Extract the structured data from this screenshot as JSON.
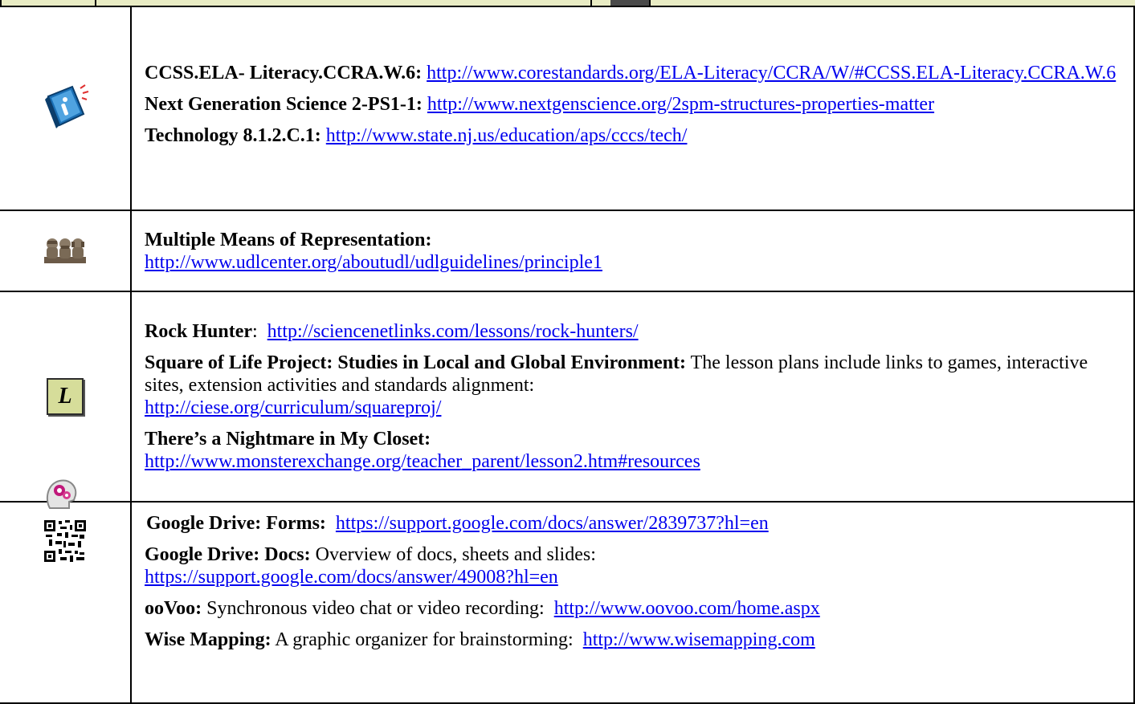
{
  "rows": [
    {
      "icon": "info-book-icon",
      "items": [
        {
          "label": "CCSS.ELA- Literacy.CCRA.W.6:",
          "text": "",
          "link": "http://www.corestandards.org/ELA-Literacy/CCRA/W/#CCSS.ELA-Literacy.CCRA.W.6"
        },
        {
          "label": "Next Generation Science 2-PS1-1:",
          "text": "",
          "link": "http://www.nextgenscience.org/2spm-structures-properties-matter"
        },
        {
          "label": "Technology 8.1.2.C.1:",
          "text": "",
          "link": "http://www.state.nj.us/education/aps/cccs/tech/"
        }
      ]
    },
    {
      "icon": "three-monkeys-icon",
      "items": [
        {
          "label": "Multiple Means of Representation:",
          "text": "",
          "link": "http://www.udlcenter.org/aboutudl/udlguidelines/principle1"
        }
      ]
    },
    {
      "icon": "lesson-l-icon",
      "icon_letter": "L",
      "items": [
        {
          "label": "Rock Hunter",
          "text": ":",
          "link": "http://sciencenetlinks.com/lessons/rock-hunters/"
        },
        {
          "label": "Square of Life Project:  Studies in Local and Global Environment:",
          "text": " The lesson plans include links to games, interactive sites, extension activities and standards alignment:",
          "link": "http://ciese.org/curriculum/squareproj/"
        },
        {
          "label": "There’s a Nightmare in My Closet:",
          "text": "",
          "link": "http://www.monsterexchange.org/teacher_parent/lesson2.htm#resources"
        }
      ]
    },
    {
      "icon": "qr-code-icon",
      "items": [
        {
          "label": "Google Drive: Forms:",
          "text": "",
          "link": "https://support.google.com/docs/answer/2839737?hl=en"
        },
        {
          "label": "Google Drive: Docs:",
          "text": "  Overview of docs, sheets and slides:",
          "link": "https://support.google.com/docs/answer/49008?hl=en"
        },
        {
          "label": "ooVoo:",
          "text": "  Synchronous video chat or video recording:",
          "link": "http://www.oovoo.com/home.aspx"
        },
        {
          "label": "Wise Mapping:",
          "text": "  A graphic organizer for brainstorming:",
          "link": "http://www.wisemapping.com"
        }
      ]
    }
  ]
}
